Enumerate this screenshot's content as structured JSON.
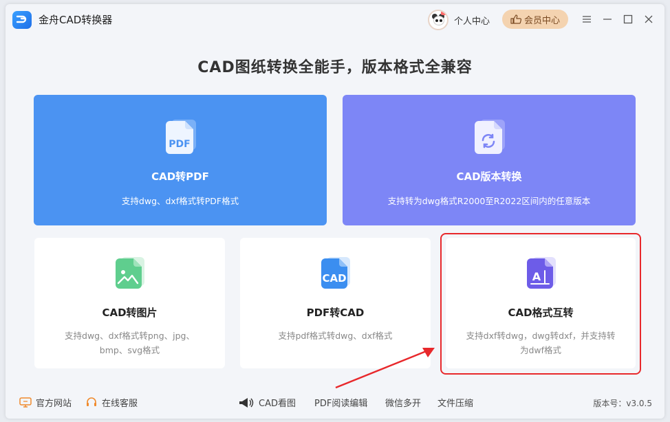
{
  "app": {
    "title": "金舟CAD转换器"
  },
  "header": {
    "personal_label": "个人中心",
    "vip_label": "会员中心"
  },
  "headline": "CAD图纸转换全能手，版本格式全兼容",
  "cards_big": [
    {
      "title": "CAD转PDF",
      "desc": "支持dwg、dxf格式转PDF格式",
      "icon_text": "PDF"
    },
    {
      "title": "CAD版本转换",
      "desc": "支持转为dwg格式R2000至R2022区间内的任意版本"
    }
  ],
  "cards_small": [
    {
      "title": "CAD转图片",
      "desc": "支持dwg、dxf格式转png、jpg、bmp、svg格式"
    },
    {
      "title": "PDF转CAD",
      "desc": "支持pdf格式转dwg、dxf格式",
      "icon_text": "CAD"
    },
    {
      "title": "CAD格式互转",
      "desc": "支持dxf转dwg，dwg转dxf，并支持转为dwf格式",
      "icon_text": "A"
    }
  ],
  "footer": {
    "website": "官方网站",
    "service": "在线客服",
    "links": [
      "CAD看图",
      "PDF阅读编辑",
      "微信多开",
      "文件压缩"
    ],
    "version": "版本号：v3.0.5"
  },
  "colors": {
    "blue": "#4b93f2",
    "purple": "#7d86f6",
    "highlight": "#e8282b",
    "vip_bg": "#f4d3b0"
  }
}
